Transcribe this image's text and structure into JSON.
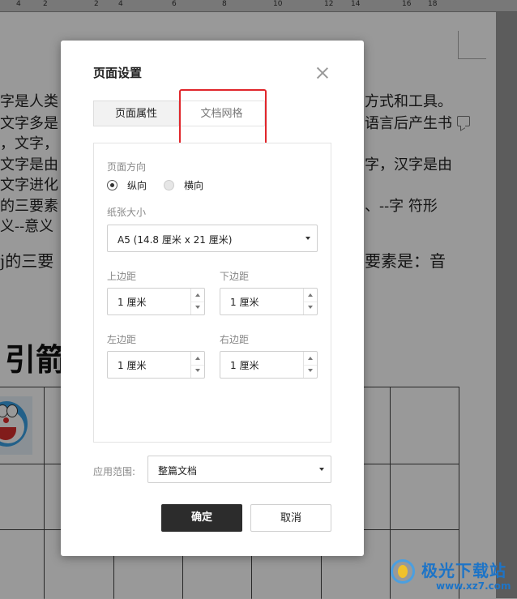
{
  "ruler": {
    "numbers": [
      "4",
      "2",
      "2",
      "4",
      "6",
      "8",
      "10",
      "12",
      "14",
      "16",
      "18"
    ]
  },
  "document": {
    "lines": [
      "字是人类",
      "文字多是",
      "，文字，",
      "文字是由",
      "文字进化",
      "的三要素",
      "义--意义",
      "j的三要"
    ],
    "right_lines": [
      "方式和工具。",
      "语言后产生书",
      "字，汉字是由",
      "、--字 符形",
      "要素是：音"
    ],
    "heading": "引箭"
  },
  "dialog": {
    "title": "页面设置",
    "tabs": [
      {
        "label": "页面属性",
        "active": true
      },
      {
        "label": "文档网格",
        "active": false
      }
    ],
    "orientation": {
      "label": "页面方向",
      "options": [
        {
          "label": "纵向",
          "checked": true
        },
        {
          "label": "横向",
          "checked": false
        }
      ]
    },
    "paper_size": {
      "label": "纸张大小",
      "value": "A5 (14.8 厘米 x 21 厘米)"
    },
    "margins": {
      "top": {
        "label": "上边距",
        "value": "1 厘米"
      },
      "bottom": {
        "label": "下边距",
        "value": "1 厘米"
      },
      "left": {
        "label": "左边距",
        "value": "1 厘米"
      },
      "right": {
        "label": "右边距",
        "value": "1 厘米"
      }
    },
    "apply_to": {
      "label": "应用范围:",
      "value": "整篇文档"
    },
    "ok_label": "确定",
    "cancel_label": "取消"
  },
  "watermark": {
    "name": "极光下载站",
    "url": "www.xz7.com"
  },
  "colors": {
    "highlight": "#e0262b",
    "primary_button": "#2c2c2c"
  }
}
